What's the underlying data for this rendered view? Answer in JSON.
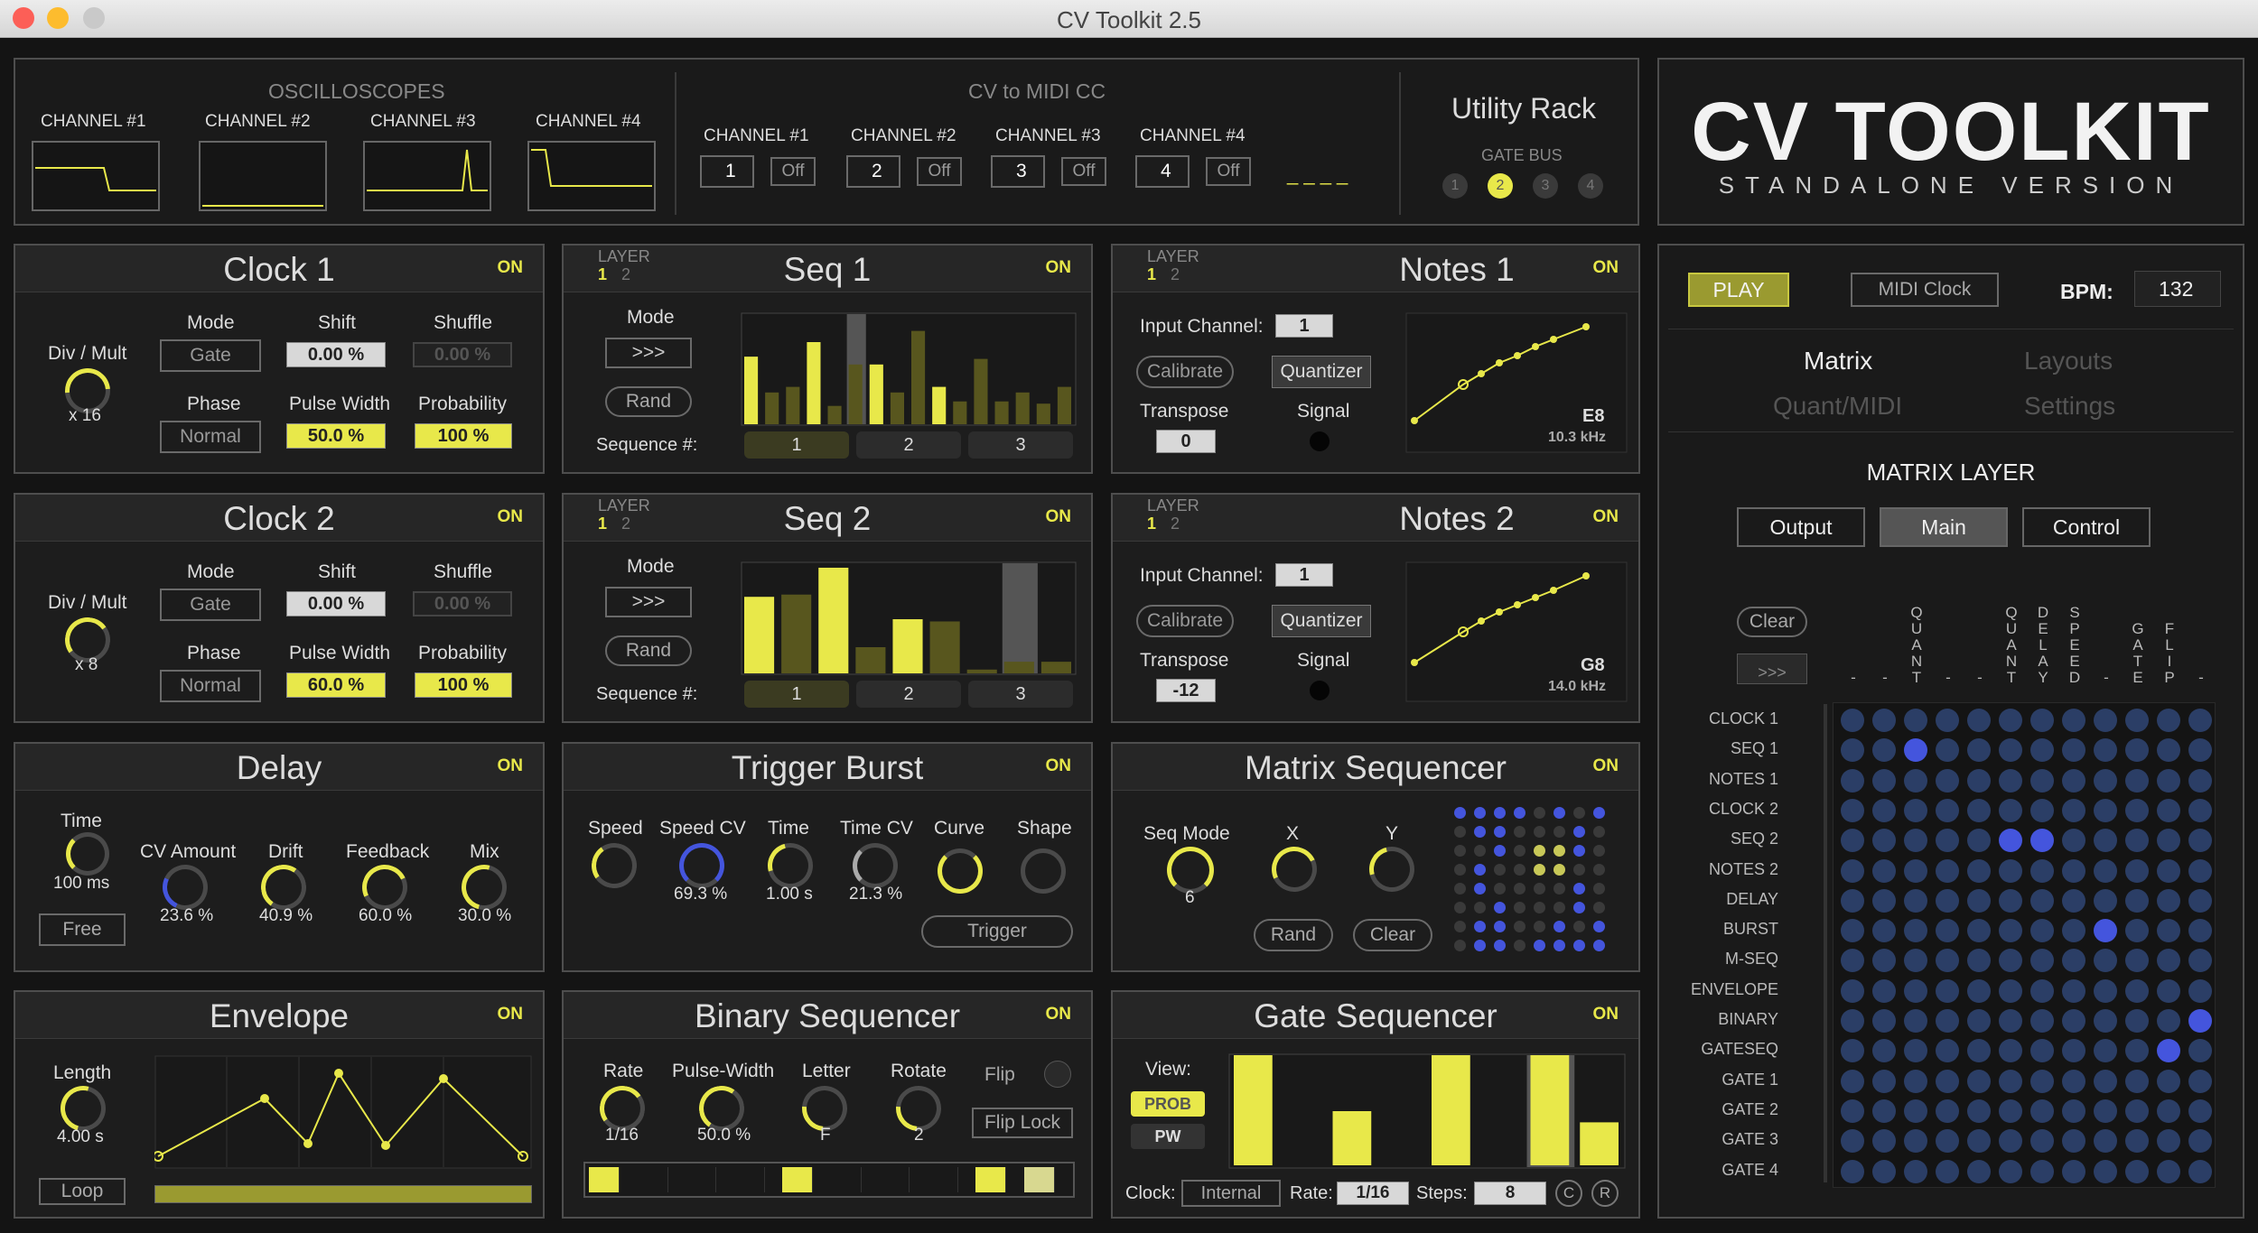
{
  "window": {
    "title": "CV Toolkit 2.5"
  },
  "colors": {
    "accent": "#e8e84a",
    "blue": "#4455dd",
    "panel": "#1d1d1d"
  },
  "osc": {
    "title": "OSCILLOSCOPES",
    "channels": [
      "CHANNEL #1",
      "CHANNEL #2",
      "CHANNEL #3",
      "CHANNEL #4"
    ]
  },
  "cv2midi": {
    "title": "CV to MIDI CC",
    "channels": [
      {
        "label": "CHANNEL #1",
        "val": "1",
        "state": "Off"
      },
      {
        "label": "CHANNEL #2",
        "val": "2",
        "state": "Off"
      },
      {
        "label": "CHANNEL #3",
        "val": "3",
        "state": "Off"
      },
      {
        "label": "CHANNEL #4",
        "val": "4",
        "state": "Off"
      }
    ],
    "dashes": "_ _ _ _"
  },
  "utility": {
    "title": "Utility Rack",
    "gate_bus": "GATE BUS",
    "buses": [
      "1",
      "2",
      "3",
      "4"
    ]
  },
  "brand": {
    "title": "CV TOOLKIT",
    "subtitle": "STANDALONE VERSION"
  },
  "common": {
    "on": "ON",
    "layer": "LAYER",
    "l1": "1",
    "l2": "2"
  },
  "clock1": {
    "title": "Clock 1",
    "divmult": "Div / Mult",
    "divval": "x 16",
    "mode_l": "Mode",
    "mode": "Gate",
    "shift_l": "Shift",
    "shift": "0.00 %",
    "shuffle_l": "Shuffle",
    "shuffle": "0.00 %",
    "phase_l": "Phase",
    "phase": "Normal",
    "pw_l": "Pulse Width",
    "pw": "50.0 %",
    "prob_l": "Probability",
    "prob": "100 %"
  },
  "clock2": {
    "title": "Clock 2",
    "divmult": "Div / Mult",
    "divval": "x 8",
    "mode_l": "Mode",
    "mode": "Gate",
    "shift_l": "Shift",
    "shift": "0.00 %",
    "shuffle_l": "Shuffle",
    "shuffle": "0.00 %",
    "phase_l": "Phase",
    "phase": "Normal",
    "pw_l": "Pulse Width",
    "pw": "60.0 %",
    "prob_l": "Probability",
    "prob": "100 %"
  },
  "seq1": {
    "title": "Seq 1",
    "mode_l": "Mode",
    "mode": ">>>",
    "rand": "Rand",
    "seqnum": "Sequence #:",
    "seqs": [
      "1",
      "2",
      "3"
    ],
    "bars": [
      0.62,
      0.3,
      0.35,
      0.75,
      0.18,
      0.55,
      0.55,
      0.3,
      0.85,
      0.35,
      0.22,
      0.6,
      0.22,
      0.3,
      0.2,
      0.35
    ]
  },
  "seq2": {
    "title": "Seq 2",
    "mode_l": "Mode",
    "mode": ">>>",
    "rand": "Rand",
    "seqnum": "Sequence #:",
    "seqs": [
      "1",
      "2",
      "3"
    ],
    "bars": [
      0.7,
      0.72,
      0.96,
      0.25,
      0.5,
      0.48,
      0.05,
      0.12,
      0.12
    ]
  },
  "notes1": {
    "title": "Notes 1",
    "in_l": "Input Channel:",
    "in": "1",
    "cal": "Calibrate",
    "quant": "Quantizer",
    "trans_l": "Transpose",
    "trans": "0",
    "sig": "Signal",
    "note": "E8",
    "freq": "10.3 kHz"
  },
  "notes2": {
    "title": "Notes 2",
    "in_l": "Input Channel:",
    "in": "1",
    "cal": "Calibrate",
    "quant": "Quantizer",
    "trans_l": "Transpose",
    "trans": "-12",
    "sig": "Signal",
    "note": "G8",
    "freq": "14.0 kHz"
  },
  "delay": {
    "title": "Delay",
    "time_l": "Time",
    "time": "100 ms",
    "free": "Free",
    "cva_l": "CV Amount",
    "cva": "23.6 %",
    "drift_l": "Drift",
    "drift": "40.9 %",
    "fb_l": "Feedback",
    "fb": "60.0 %",
    "mix_l": "Mix",
    "mix": "30.0 %"
  },
  "burst": {
    "title": "Trigger Burst",
    "speed_l": "Speed",
    "speedcv_l": "Speed CV",
    "speedcv": "69.3 %",
    "time_l": "Time",
    "time": "1.00 s",
    "timecv_l": "Time CV",
    "timecv": "21.3 %",
    "curve_l": "Curve",
    "shape_l": "Shape",
    "trigger": "Trigger"
  },
  "mseq": {
    "title": "Matrix Sequencer",
    "mode_l": "Seq Mode",
    "mode": "6",
    "x_l": "X",
    "y_l": "Y",
    "rand": "Rand",
    "clear": "Clear"
  },
  "envelope": {
    "title": "Envelope",
    "len_l": "Length",
    "len": "4.00 s",
    "loop": "Loop"
  },
  "binseq": {
    "title": "Binary Sequencer",
    "rate_l": "Rate",
    "rate": "1/16",
    "pw_l": "Pulse-Width",
    "pw": "50.0 %",
    "letter_l": "Letter",
    "letter": "F",
    "rot_l": "Rotate",
    "rot": "2",
    "flip": "Flip",
    "fliplock": "Flip Lock"
  },
  "gateseq": {
    "title": "Gate Sequencer",
    "view": "View:",
    "prob": "PROB",
    "pw": "PW",
    "clock_l": "Clock:",
    "clock": "Internal",
    "rate_l": "Rate:",
    "rate": "1/16",
    "steps_l": "Steps:",
    "steps": "8",
    "c": "C",
    "r": "R",
    "bars": [
      1,
      0,
      0.5,
      0,
      1,
      0,
      1,
      0.4
    ]
  },
  "right": {
    "play": "PLAY",
    "midiclock": "MIDI Clock",
    "bpm_l": "BPM:",
    "bpm": "132",
    "tabs": [
      "Matrix",
      "Layouts",
      "Quant/MIDI",
      "Settings"
    ],
    "matrix_layer": "MATRIX LAYER",
    "seg": [
      "Output",
      "Main",
      "Control"
    ],
    "clear": "Clear",
    "arrow": ">>>",
    "rows": [
      "CLOCK 1",
      "SEQ 1",
      "NOTES 1",
      "CLOCK 2",
      "SEQ 2",
      "NOTES 2",
      "DELAY",
      "BURST",
      "M-SEQ",
      "ENVELOPE",
      "BINARY",
      "GATESEQ",
      "GATE 1",
      "GATE 2",
      "GATE 3",
      "GATE 4"
    ],
    "cols": [
      "-",
      "-",
      "QUANT",
      "-",
      "-",
      "QUANT",
      "DELAY",
      "SPEED",
      "-",
      "GATE",
      "FLIP",
      "-"
    ]
  }
}
